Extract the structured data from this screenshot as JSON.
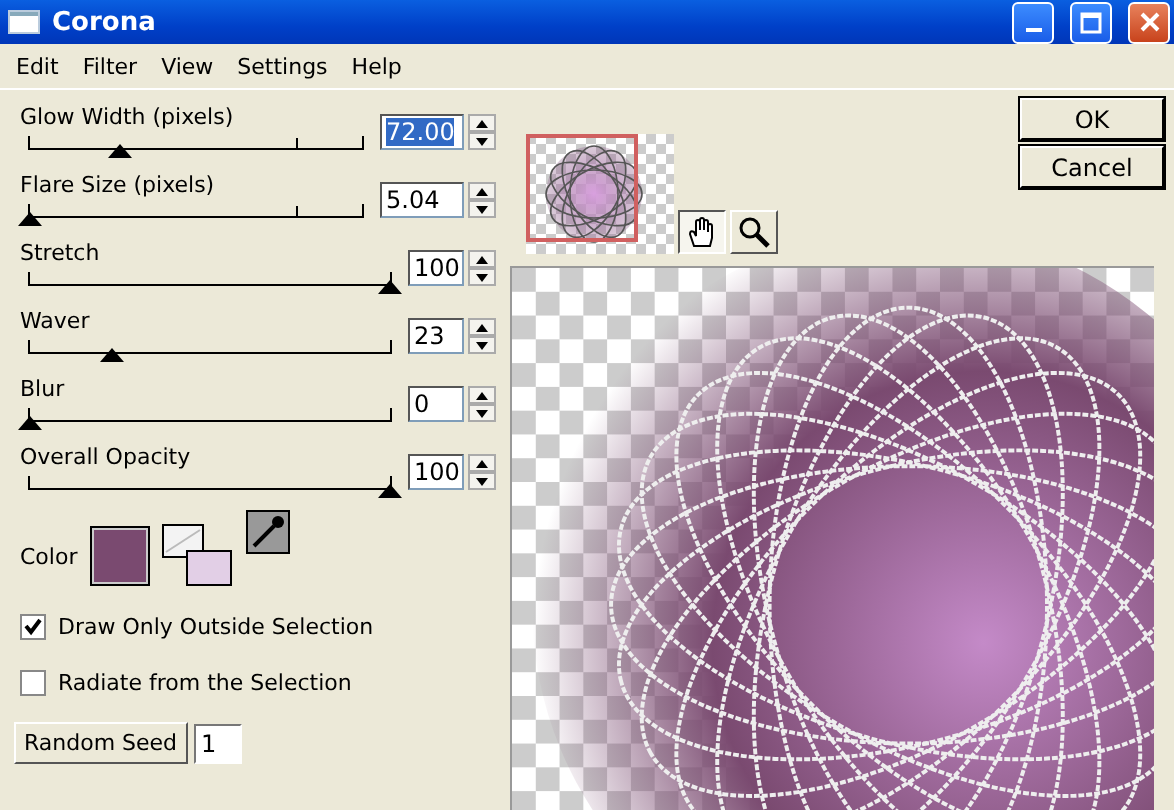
{
  "window": {
    "title": "Corona"
  },
  "menu": [
    "Edit",
    "Filter",
    "View",
    "Settings",
    "Help"
  ],
  "sliders": [
    {
      "label": "Glow Width (pixels)",
      "value": "72.00",
      "value_selected": true,
      "level": 0.27,
      "wide": true
    },
    {
      "label": "Flare Size (pixels)",
      "value": "5.04",
      "value_selected": false,
      "level": 0,
      "wide": true
    },
    {
      "label": "Stretch",
      "value": "100",
      "value_selected": false,
      "level": 1,
      "wide": false
    },
    {
      "label": "Waver",
      "value": "23",
      "value_selected": false,
      "level": 0.23,
      "wide": false
    },
    {
      "label": "Blur",
      "value": "0",
      "value_selected": false,
      "level": 0,
      "wide": false
    },
    {
      "label": "Overall Opacity",
      "value": "100",
      "value_selected": false,
      "level": 1,
      "wide": false
    }
  ],
  "color": {
    "label": "Color",
    "color": "#7a4a70"
  },
  "checkboxes": [
    {
      "label": "Draw Only Outside Selection",
      "checked": true
    },
    {
      "label": "Radiate from the Selection",
      "checked": false
    }
  ],
  "random_seed": {
    "button": "Random Seed",
    "value": "1"
  },
  "tools": [
    {
      "kind": "hand",
      "selected": true
    },
    {
      "kind": "zoom",
      "selected": false
    }
  ],
  "buttons": [
    "OK",
    "Cancel"
  ]
}
